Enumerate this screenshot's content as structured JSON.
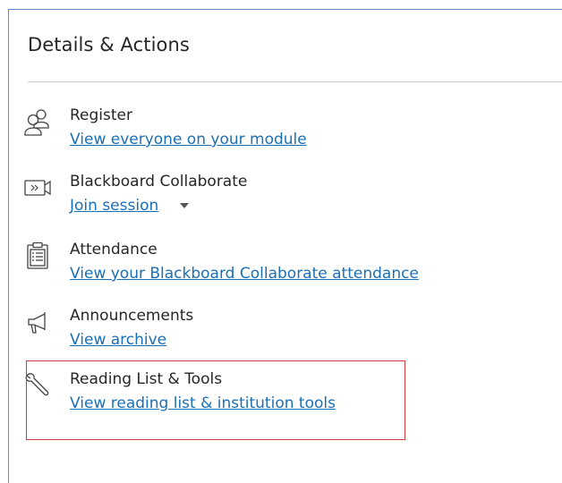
{
  "panel": {
    "title": "Details & Actions"
  },
  "items": [
    {
      "label": "Register",
      "link": "View everyone on your module",
      "icon": "people-icon"
    },
    {
      "label": "Blackboard Collaborate",
      "link": "Join session",
      "icon": "video-session-icon"
    },
    {
      "label": "Attendance",
      "link": "View your Blackboard Collaborate attendance",
      "icon": "clipboard-icon"
    },
    {
      "label": "Announcements",
      "link": "View archive",
      "icon": "megaphone-icon"
    },
    {
      "label": "Reading List & Tools",
      "link": "View reading list & institution tools",
      "icon": "wrench-icon"
    }
  ],
  "colors": {
    "link": "#1b6fb6",
    "text": "#262626",
    "panel_border": "#5a8fd0",
    "highlight": "#d33b3b"
  }
}
